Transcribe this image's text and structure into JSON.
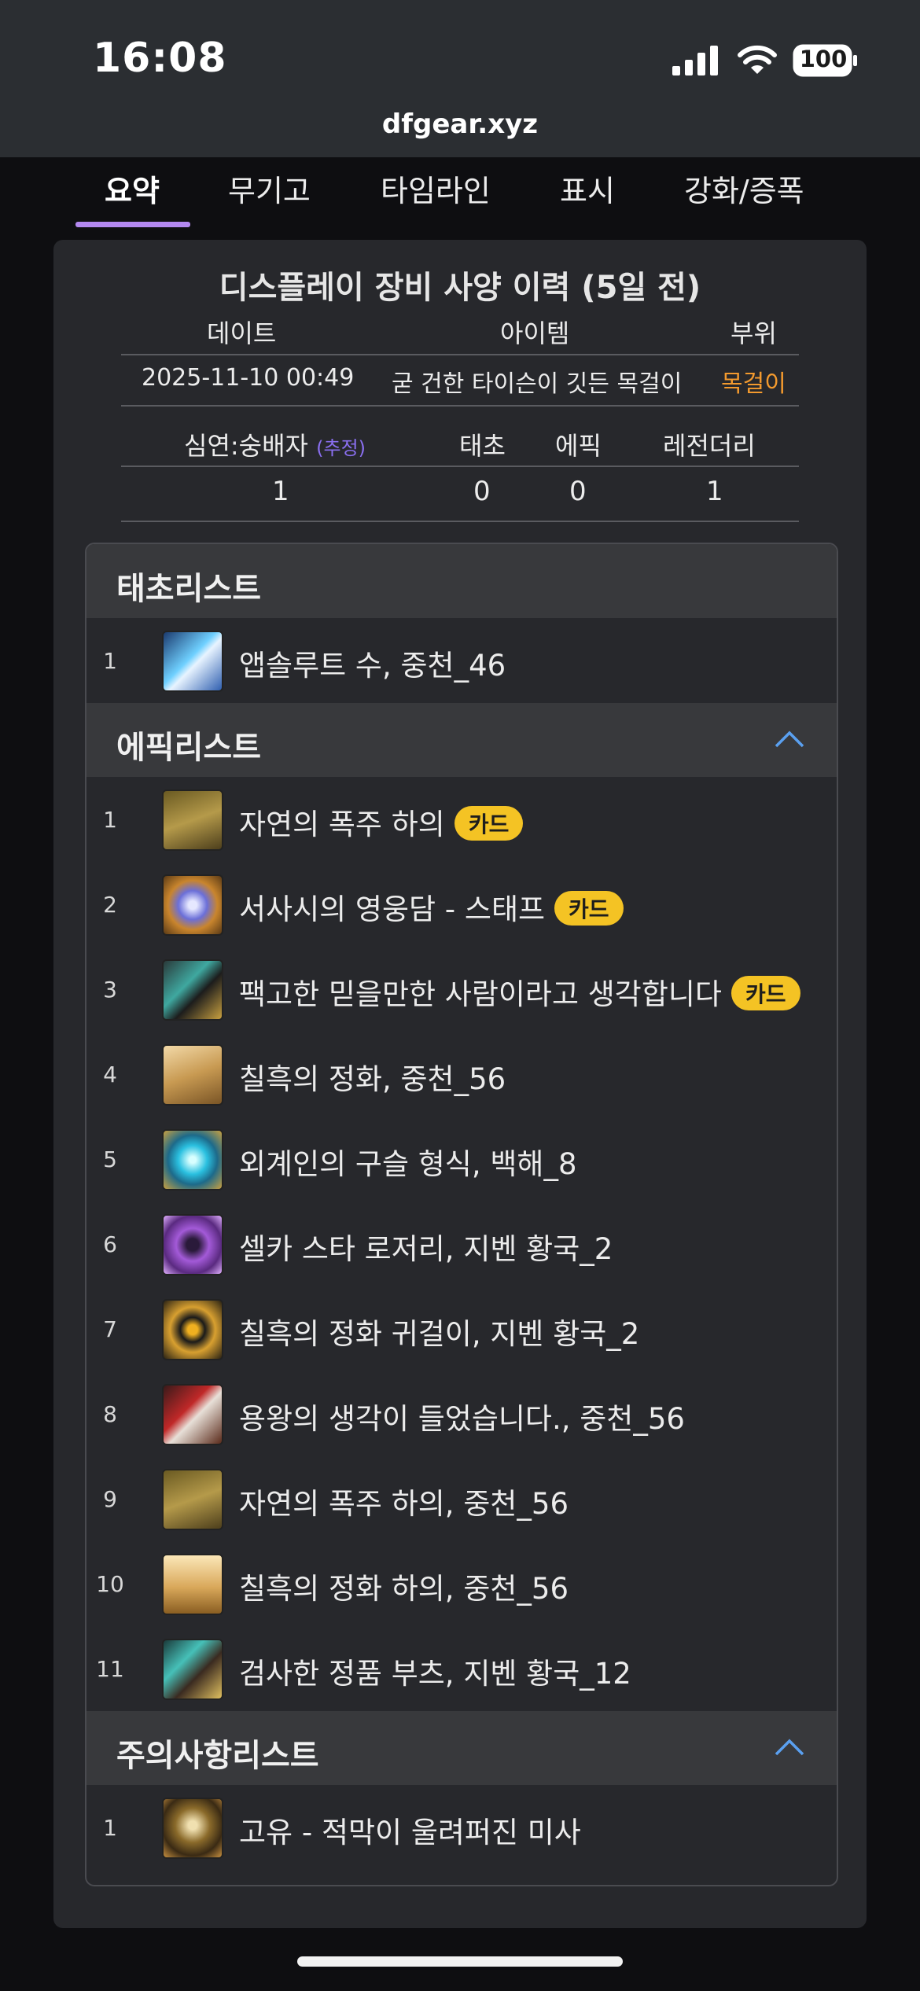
{
  "status": {
    "time": "16:08",
    "battery": "100"
  },
  "browser": {
    "url": "dfgear.xyz"
  },
  "tabs": [
    "요약",
    "무기고",
    "타임라인",
    "표시",
    "강화/증폭"
  ],
  "card": {
    "title": "디스플레이 장비 사양 이력 (5일 전)",
    "history_headers": {
      "date": "데이트",
      "item": "아이템",
      "slot": "부위"
    },
    "history_row": {
      "date": "2025-11-10 00:49",
      "item": "굳 건한 타이슨이 깃든 목걸이",
      "slot": "목걸이"
    },
    "counts_headers": {
      "depth": "심연:숭배자",
      "estimate": "(추정)",
      "taecho": "태초",
      "epic": "에픽",
      "legendary": "레전더리"
    },
    "counts_values": {
      "depth": "1",
      "taecho": "0",
      "epic": "0",
      "legendary": "1"
    }
  },
  "sections": {
    "taecho": {
      "title": "태초리스트",
      "items": [
        {
          "num": "1",
          "name": "앱솔루트 수, 중천_46"
        }
      ]
    },
    "epic": {
      "title": "에픽리스트",
      "badge": "카드",
      "items": [
        {
          "num": "1",
          "name": "자연의 폭주 하의"
        },
        {
          "num": "2",
          "name": "서사시의 영웅담 - 스태프"
        },
        {
          "num": "3",
          "name": "팩고한 믿을만한 사람이라고 생각합니다"
        },
        {
          "num": "4",
          "name": "칠흑의 정화, 중천_56"
        },
        {
          "num": "5",
          "name": "외계인의 구슬 형식, 백해_8"
        },
        {
          "num": "6",
          "name": "셀카 스타 로저리, 지벤 황국_2"
        },
        {
          "num": "7",
          "name": "칠흑의 정화 귀걸이, 지벤 황국_2"
        },
        {
          "num": "8",
          "name": "용왕의 생각이 들었습니다., 중천_56"
        },
        {
          "num": "9",
          "name": "자연의 폭주 하의, 중천_56"
        },
        {
          "num": "10",
          "name": "칠흑의 정화 하의, 중천_56"
        },
        {
          "num": "11",
          "name": "검사한 정품 부츠, 지벤 황국_12"
        }
      ]
    },
    "caution": {
      "title": "주의사항리스트",
      "items": [
        {
          "num": "1",
          "name": "고유 - 적막이 울려퍼진 미사"
        }
      ]
    }
  }
}
